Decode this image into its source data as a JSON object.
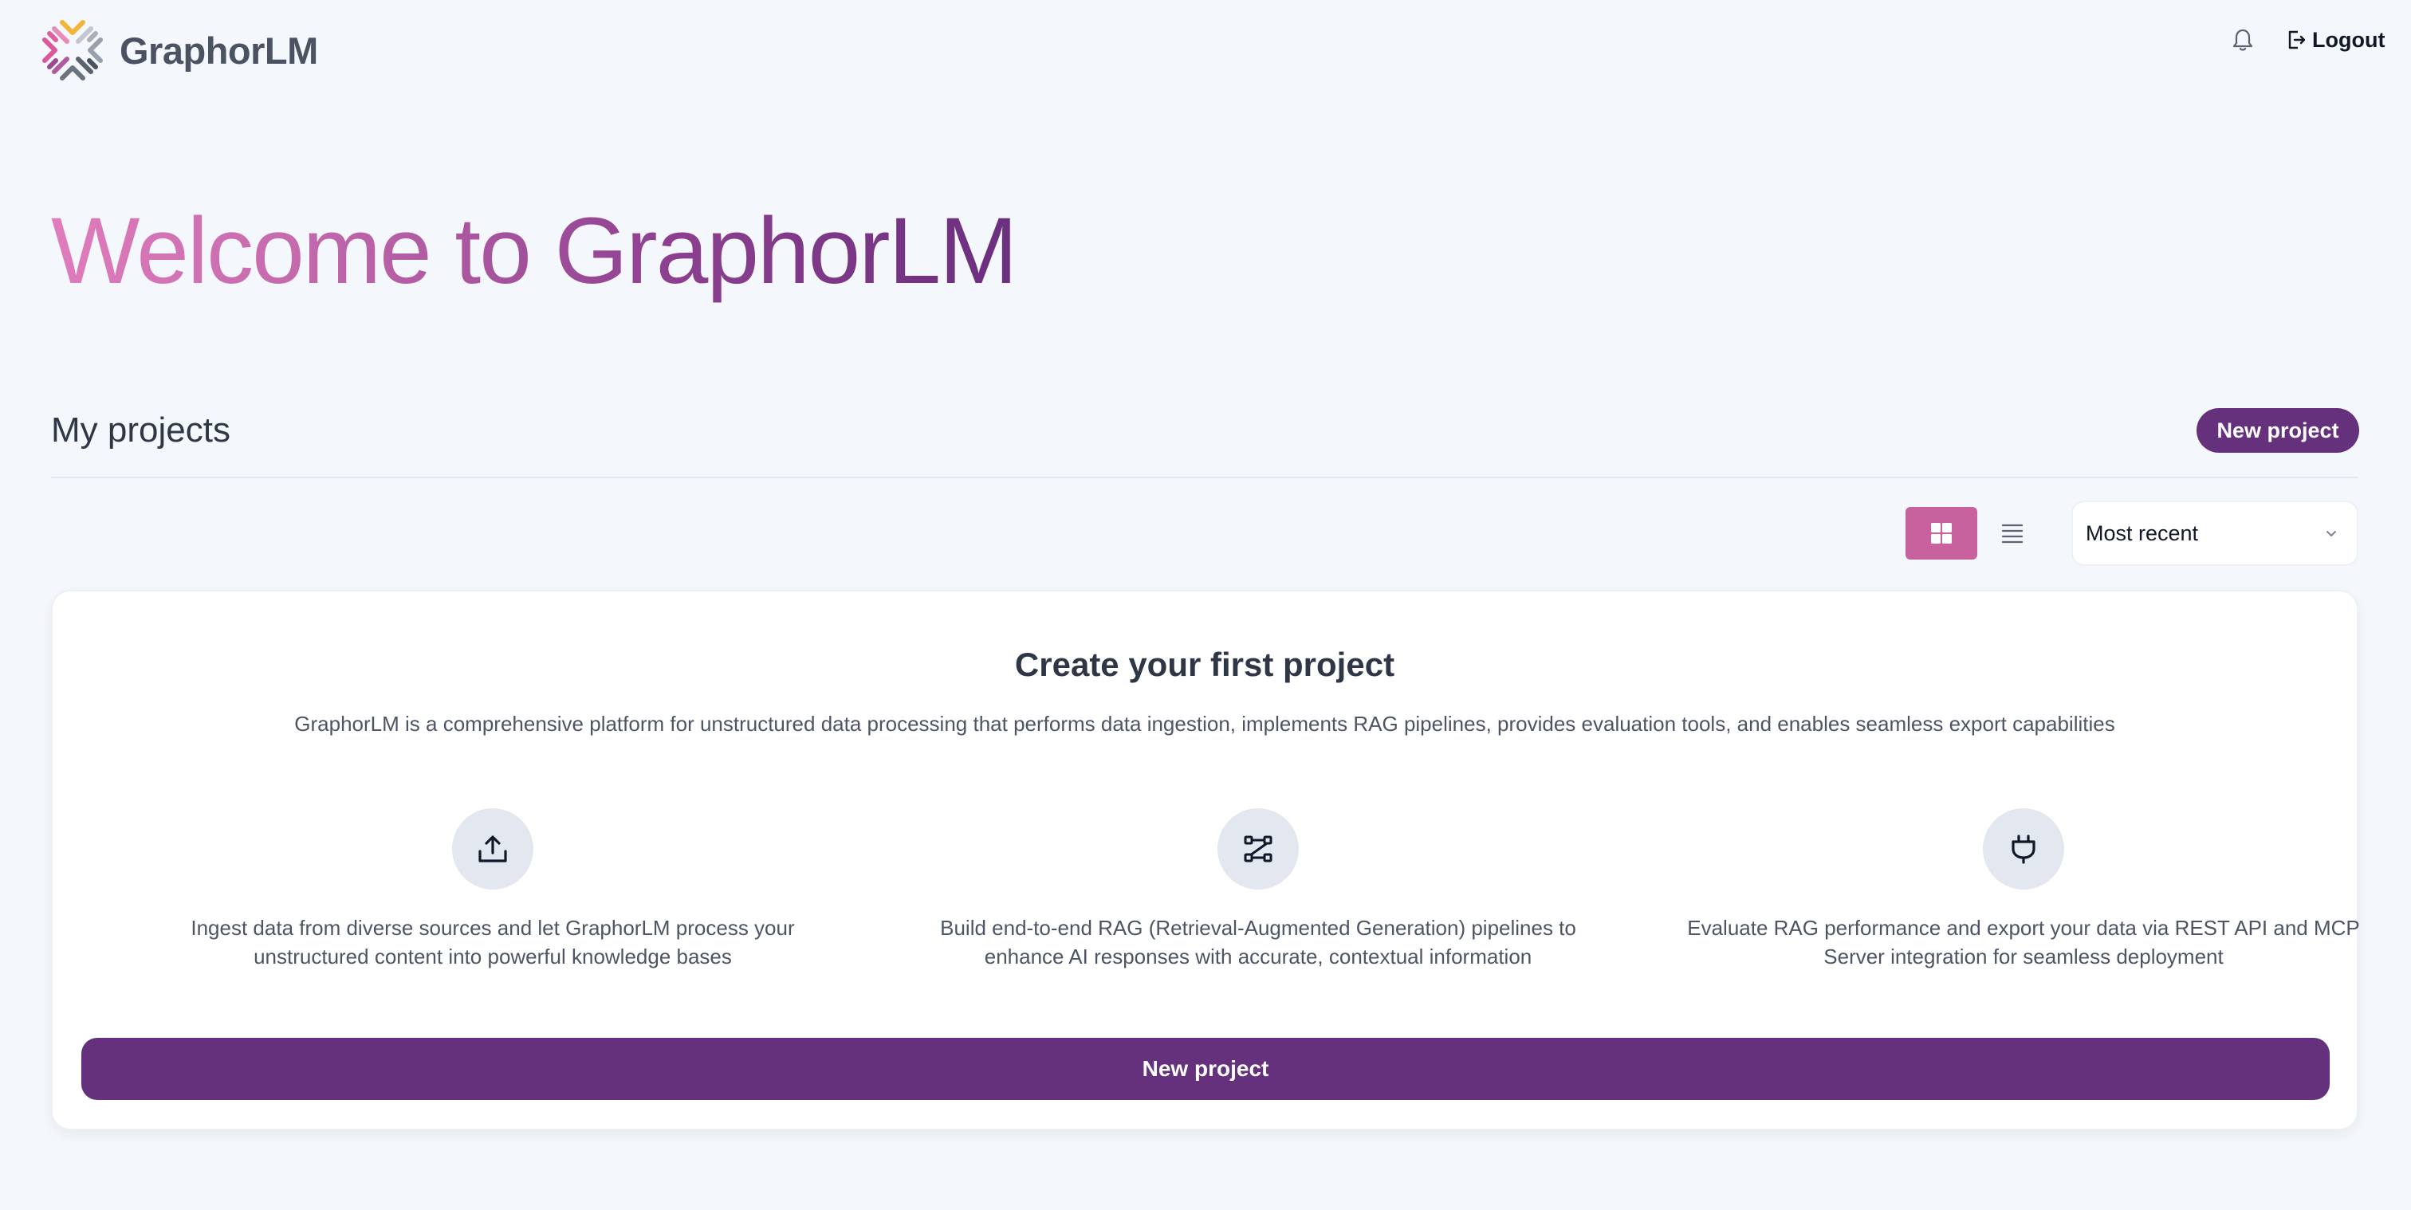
{
  "app": {
    "name": "GraphorLM"
  },
  "header": {
    "logo_text": "GraphorLM",
    "logout_label": "Logout"
  },
  "welcome": {
    "title": "Welcome to GraphorLM"
  },
  "projects": {
    "title": "My projects",
    "new_project_label": "New project",
    "view_modes": [
      "grid",
      "list"
    ],
    "active_view": "grid",
    "sort": {
      "selected": "Most recent"
    }
  },
  "empty_state": {
    "title": "Create your first project",
    "description": "GraphorLM is a comprehensive platform for unstructured data processing that performs data ingestion, implements RAG pipelines, provides evaluation tools, and enables seamless export capabilities",
    "features": [
      {
        "icon": "upload-icon",
        "line1": "Ingest data from diverse sources and let GraphorLM process your",
        "line2": "unstructured content into powerful knowledge bases"
      },
      {
        "icon": "pipeline-icon",
        "line1": "Build end-to-end RAG (Retrieval-Augmented Generation) pipelines to",
        "line2": "enhance AI responses with accurate, contextual information"
      },
      {
        "icon": "plug-icon",
        "line1": "Evaluate RAG performance and export your data via REST API and MCP",
        "line2": "Server integration for seamless deployment"
      }
    ],
    "button_label": "New project"
  },
  "colors": {
    "primary": "#65307c",
    "accent": "#c8629f",
    "background": "#f4f7fb",
    "gradient_start": "#e07cbc",
    "gradient_end": "#6a2f7e"
  }
}
